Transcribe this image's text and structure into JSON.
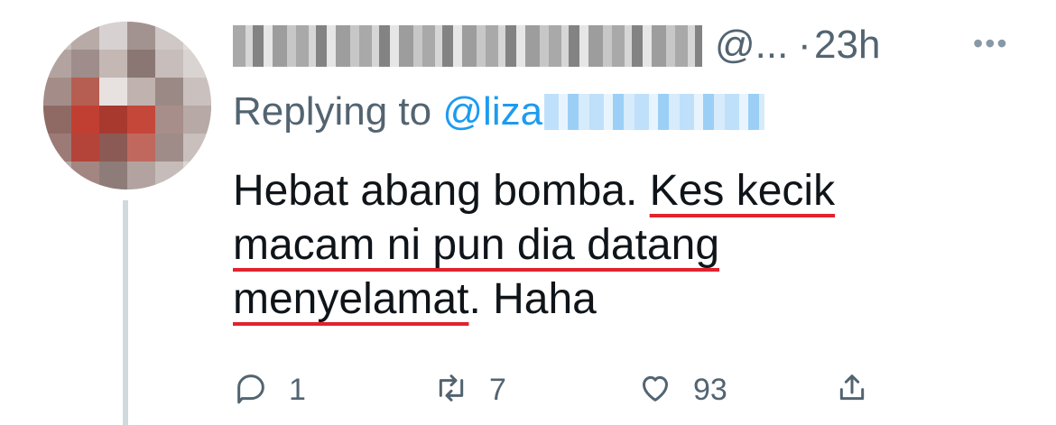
{
  "tweet": {
    "handle": "@...",
    "separator": "·",
    "time": "23h",
    "more_label": "•••",
    "reply_prefix": "Replying to",
    "reply_mention": "@liza",
    "body": {
      "part1": "Hebat abang bomba. ",
      "part2": "Kes kecik macam ni pun dia datang menyelamat",
      "part3": ". Haha"
    },
    "actions": {
      "reply_count": "1",
      "retweet_count": "7",
      "like_count": "93"
    },
    "icons": {
      "reply": "comment-bubble-icon",
      "retweet": "retweet-icon",
      "like": "heart-icon",
      "share": "share-icon",
      "more": "more-dots-icon"
    },
    "colors": {
      "link": "#1d9bf0",
      "secondary_text": "#536471",
      "underline_annotation": "#e0232e"
    }
  }
}
